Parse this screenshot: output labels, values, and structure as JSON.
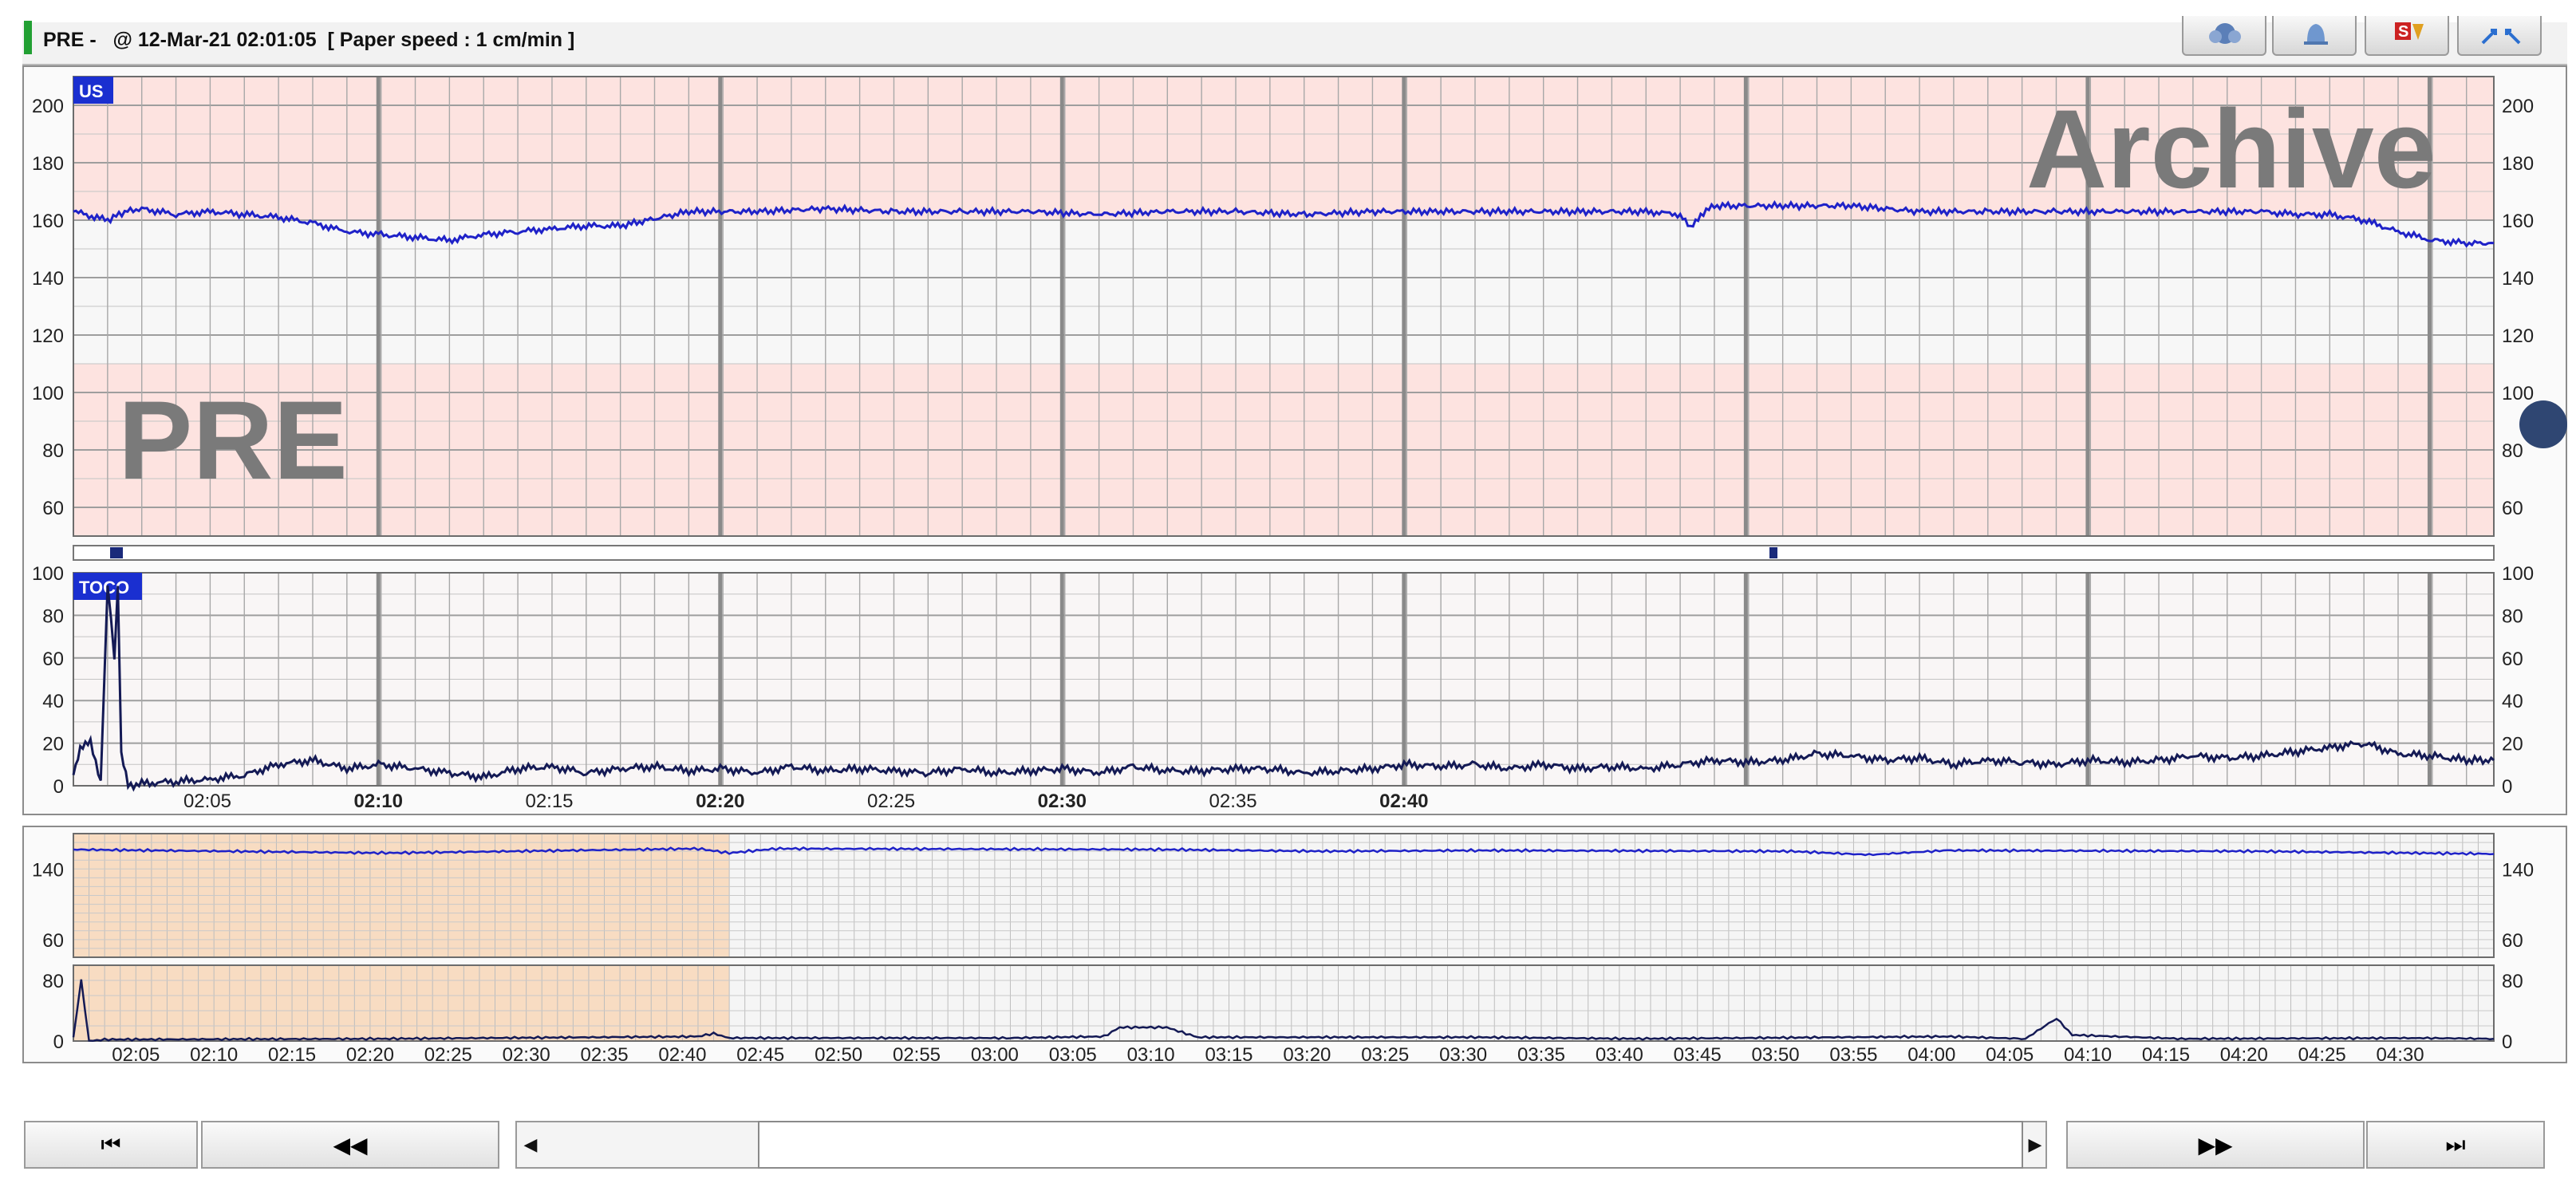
{
  "header": {
    "mode": "PRE -",
    "datetime": "@ 12-Mar-21 02:01:05",
    "paper_speed": "[ Paper speed : 1 cm/min ]"
  },
  "toolbar": {
    "buttons": [
      {
        "icon": "gear-cloud-icon"
      },
      {
        "icon": "bell-icon"
      },
      {
        "icon": "signature-icon",
        "label": "S"
      },
      {
        "icon": "expand-arrows-icon"
      }
    ]
  },
  "watermarks": {
    "archive": "Archive",
    "pre": "PRE"
  },
  "us_panel": {
    "label": "US",
    "y_ticks": [
      "200",
      "180",
      "160",
      "140",
      "120",
      "100",
      "80",
      "60"
    ],
    "colors": {
      "band": "#fde3e0",
      "trace": "#1f22c8",
      "label_bg": "#1a2fd0"
    }
  },
  "toco_panel": {
    "label": "TOCO",
    "y_ticks": [
      "100",
      "80",
      "60",
      "40",
      "20",
      "0"
    ]
  },
  "time_axis": {
    "labels": [
      "02:05",
      "02:10",
      "02:15",
      "02:20",
      "02:25",
      "02:30",
      "02:35",
      "02:40"
    ],
    "bold": [
      "02:10",
      "02:20",
      "02:30",
      "02:40"
    ]
  },
  "us_trace_points": [
    [
      0,
      163
    ],
    [
      0.3,
      162
    ],
    [
      1,
      160
    ],
    [
      1.5,
      163
    ],
    [
      2,
      164
    ],
    [
      3,
      162
    ],
    [
      4,
      163
    ],
    [
      5,
      162
    ],
    [
      6,
      161
    ],
    [
      7,
      159
    ],
    [
      8,
      156
    ],
    [
      9,
      155
    ],
    [
      10,
      154
    ],
    [
      11,
      153
    ],
    [
      12,
      155
    ],
    [
      13,
      156
    ],
    [
      14,
      157
    ],
    [
      15,
      158
    ],
    [
      16,
      158
    ],
    [
      18,
      163
    ],
    [
      20,
      163
    ],
    [
      22,
      164
    ],
    [
      24,
      163
    ],
    [
      26,
      163
    ],
    [
      28,
      163
    ],
    [
      30,
      162
    ],
    [
      32,
      163
    ],
    [
      34,
      163
    ],
    [
      36,
      162
    ],
    [
      38,
      163
    ],
    [
      40,
      163
    ],
    [
      42,
      163
    ],
    [
      44,
      163
    ],
    [
      46,
      163
    ],
    [
      47,
      162
    ],
    [
      47.3,
      157
    ],
    [
      47.6,
      162
    ],
    [
      48,
      165
    ],
    [
      50,
      165
    ],
    [
      52,
      165
    ],
    [
      54,
      163
    ],
    [
      56,
      163
    ],
    [
      58,
      163
    ],
    [
      60,
      163
    ],
    [
      62,
      163
    ],
    [
      64,
      163
    ],
    [
      65,
      162
    ],
    [
      66,
      162
    ],
    [
      67,
      160
    ],
    [
      68,
      156
    ],
    [
      69,
      153
    ],
    [
      70,
      152
    ],
    [
      70.8,
      152
    ]
  ],
  "toco_trace_points": [
    [
      0,
      5
    ],
    [
      0.2,
      18
    ],
    [
      0.5,
      20
    ],
    [
      0.8,
      2
    ],
    [
      1,
      95
    ],
    [
      1.2,
      60
    ],
    [
      1.3,
      95
    ],
    [
      1.4,
      15
    ],
    [
      1.6,
      0
    ],
    [
      2,
      1
    ],
    [
      3,
      2
    ],
    [
      4,
      3
    ],
    [
      5,
      5
    ],
    [
      6,
      10
    ],
    [
      7,
      12
    ],
    [
      8,
      8
    ],
    [
      9,
      10
    ],
    [
      10,
      8
    ],
    [
      11,
      6
    ],
    [
      12,
      4
    ],
    [
      13,
      8
    ],
    [
      14,
      9
    ],
    [
      15,
      6
    ],
    [
      16,
      8
    ],
    [
      17,
      9
    ],
    [
      18,
      7
    ],
    [
      19,
      8
    ],
    [
      20,
      6
    ],
    [
      21,
      9
    ],
    [
      22,
      7
    ],
    [
      23,
      8
    ],
    [
      24,
      7
    ],
    [
      25,
      6
    ],
    [
      26,
      8
    ],
    [
      27,
      6
    ],
    [
      28,
      7
    ],
    [
      29,
      8
    ],
    [
      30,
      6
    ],
    [
      31,
      9
    ],
    [
      32,
      7
    ],
    [
      33,
      7
    ],
    [
      34,
      8
    ],
    [
      35,
      8
    ],
    [
      36,
      6
    ],
    [
      37,
      7
    ],
    [
      38,
      8
    ],
    [
      39,
      10
    ],
    [
      40,
      9
    ],
    [
      41,
      10
    ],
    [
      42,
      8
    ],
    [
      43,
      10
    ],
    [
      44,
      8
    ],
    [
      45,
      9
    ],
    [
      46,
      8
    ],
    [
      47,
      10
    ],
    [
      48,
      12
    ],
    [
      49,
      11
    ],
    [
      50,
      12
    ],
    [
      51,
      15
    ],
    [
      52,
      14
    ],
    [
      53,
      12
    ],
    [
      54,
      13
    ],
    [
      55,
      10
    ],
    [
      56,
      12
    ],
    [
      57,
      11
    ],
    [
      58,
      10
    ],
    [
      59,
      12
    ],
    [
      60,
      11
    ],
    [
      61,
      12
    ],
    [
      62,
      14
    ],
    [
      63,
      13
    ],
    [
      64,
      14
    ],
    [
      65,
      16
    ],
    [
      66,
      18
    ],
    [
      67,
      20
    ],
    [
      68,
      15
    ],
    [
      69,
      14
    ],
    [
      70,
      12
    ],
    [
      70.8,
      12
    ]
  ],
  "overview": {
    "us_ticks": [
      "140",
      "60"
    ],
    "toco_ticks": [
      "80",
      "0"
    ],
    "time_labels": [
      "02:05",
      "02:10",
      "02:15",
      "02:20",
      "02:25",
      "02:30",
      "02:35",
      "02:40",
      "02:45",
      "02:50",
      "02:55",
      "03:00",
      "03:05",
      "03:10",
      "03:15",
      "03:20",
      "03:25",
      "03:30",
      "03:35",
      "03:40",
      "03:45",
      "03:50",
      "03:55",
      "04:00",
      "04:05",
      "04:10",
      "04:15",
      "04:20",
      "04:25",
      "04:30"
    ],
    "highlight_color": "#f8dcc2"
  },
  "navigation": {
    "first": "⏮",
    "prev": "◀◀",
    "scroll_left": "◀",
    "scroll_right": "▶",
    "next": "▶▶",
    "last": "⏭"
  }
}
